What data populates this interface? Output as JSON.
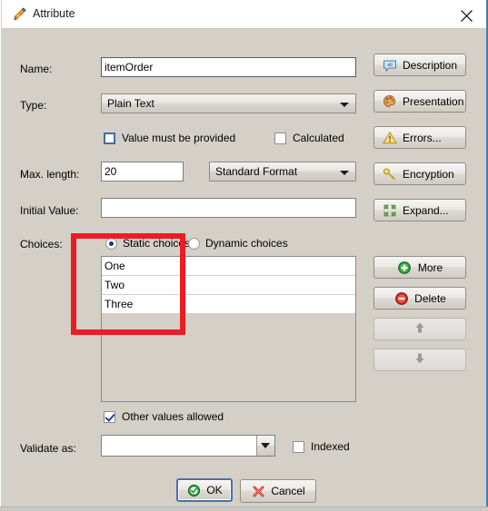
{
  "window": {
    "title": "Attribute",
    "title_icon": "attribute-pencil-icon",
    "close_label": "✕",
    "border_color": "#3c7fb1",
    "background_color": "#d4d0c8"
  },
  "form": {
    "name": {
      "label": "Name:",
      "value": "itemOrder",
      "placeholder": ""
    },
    "type": {
      "label": "Type:",
      "value": "Plain Text"
    },
    "value_required": {
      "label": "Value must be provided",
      "checked": false
    },
    "calculated": {
      "label": "Calculated",
      "checked": false
    },
    "max_length": {
      "label": "Max. length:",
      "value": "20"
    },
    "format": {
      "value": "Standard Format"
    },
    "initial_value": {
      "label": "Initial Value:",
      "value": ""
    },
    "choices": {
      "label": "Choices:",
      "static_label": "Static choices",
      "dynamic_label": "Dynamic choices",
      "selected_mode": "Static choices",
      "items": [
        "One",
        "Two",
        "Three"
      ]
    },
    "other_values_allowed": {
      "label": "Other values allowed",
      "checked": true
    },
    "validate_as": {
      "label": "Validate as:",
      "value": ""
    },
    "indexed": {
      "label": "Indexed",
      "checked": false
    }
  },
  "side_buttons": [
    {
      "label": "Description",
      "icon": "speech-bubble-icon",
      "enabled": true
    },
    {
      "label": "Presentation",
      "icon": "palette-icon",
      "enabled": true
    },
    {
      "label": "Errors...",
      "icon": "warning-triangle-icon",
      "enabled": true
    },
    {
      "label": "Encryption",
      "icon": "key-icon",
      "enabled": true
    },
    {
      "label": "Expand...",
      "icon": "expand-arrows-icon",
      "enabled": true
    }
  ],
  "list_buttons": [
    {
      "label": "More",
      "icon": "green-plus-icon",
      "enabled": true
    },
    {
      "label": "Delete",
      "icon": "red-minus-icon",
      "enabled": true
    },
    {
      "label": "↑",
      "icon": "arrow-up-icon",
      "enabled": false
    },
    {
      "label": "↓",
      "icon": "arrow-down-icon",
      "enabled": false
    }
  ],
  "footer": {
    "ok": {
      "label": "OK",
      "icon": "green-check-icon",
      "is_default": true
    },
    "cancel": {
      "label": "Cancel",
      "icon": "red-x-icon",
      "is_default": false
    }
  },
  "annotation": {
    "color": "#ec1c24",
    "shape": "rectangle"
  }
}
